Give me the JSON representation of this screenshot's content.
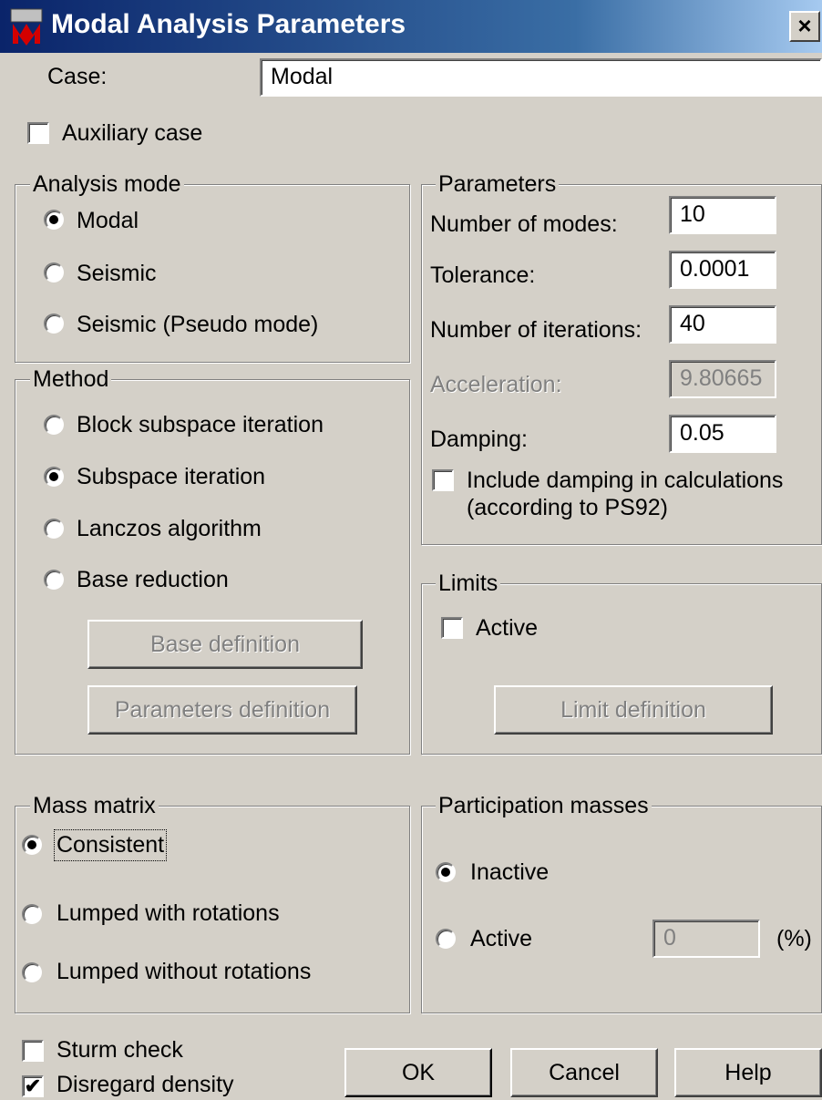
{
  "window": {
    "title": "Modal Analysis Parameters",
    "close_glyph": "×",
    "icon": "robot-app-icon"
  },
  "case": {
    "label": "Case:",
    "value": "Modal"
  },
  "auxiliary_case": {
    "label": "Auxiliary case",
    "checked": false
  },
  "analysis_mode": {
    "legend": "Analysis mode",
    "options": [
      {
        "label": "Modal",
        "selected": true
      },
      {
        "label": "Seismic",
        "selected": false
      },
      {
        "label": "Seismic (Pseudo mode)",
        "selected": false
      }
    ]
  },
  "method": {
    "legend": "Method",
    "options": [
      {
        "label": "Block subspace iteration",
        "selected": false
      },
      {
        "label": "Subspace iteration",
        "selected": true
      },
      {
        "label": "Lanczos algorithm",
        "selected": false
      },
      {
        "label": "Base reduction",
        "selected": false
      }
    ],
    "base_definition_label": "Base definition",
    "parameters_definition_label": "Parameters definition"
  },
  "parameters": {
    "legend": "Parameters",
    "number_of_modes": {
      "label": "Number of modes:",
      "value": "10"
    },
    "tolerance": {
      "label": "Tolerance:",
      "value": "0.0001"
    },
    "number_of_iterations": {
      "label": "Number of iterations:",
      "value": "40"
    },
    "acceleration": {
      "label": "Acceleration:",
      "value": "9.80665",
      "enabled": false
    },
    "damping": {
      "label": "Damping:",
      "value": "0.05"
    },
    "include_damping": {
      "line1": "Include damping in calculations",
      "line2": "(according to PS92)",
      "checked": false
    }
  },
  "limits": {
    "legend": "Limits",
    "active_label": "Active",
    "active_checked": false,
    "limit_definition_label": "Limit definition"
  },
  "mass_matrix": {
    "legend": "Mass matrix",
    "options": [
      {
        "label": "Consistent",
        "selected": true
      },
      {
        "label": "Lumped with rotations",
        "selected": false
      },
      {
        "label": "Lumped without rotations",
        "selected": false
      }
    ]
  },
  "participation_masses": {
    "legend": "Participation masses",
    "inactive_label": "Inactive",
    "active_label": "Active",
    "selected": "Inactive",
    "value": "0",
    "unit": "(%)"
  },
  "sturm_check": {
    "label": "Sturm check",
    "checked": false
  },
  "disregard_density": {
    "label": "Disregard density",
    "checked": true,
    "check_glyph": "✔"
  },
  "buttons": {
    "ok": "OK",
    "cancel": "Cancel",
    "help": "Help"
  }
}
